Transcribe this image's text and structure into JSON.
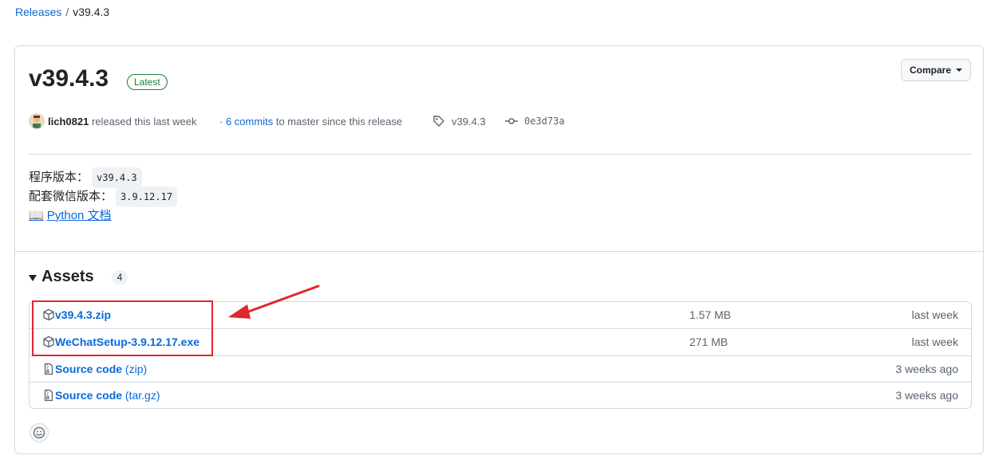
{
  "breadcrumb": {
    "releases": "Releases",
    "separator": "/",
    "current": "v39.4.3"
  },
  "release": {
    "title": "v39.4.3",
    "badge": "Latest",
    "compare_label": "Compare",
    "author": "lich0821",
    "released_text": "released this last week",
    "commits_prefix": "·",
    "commits_link": "6 commits",
    "commits_suffix": "to master since this release",
    "tag": "v39.4.3",
    "commit_sha": "0e3d73a"
  },
  "body": {
    "program_version_label": "程序版本：",
    "program_version": "v39.4.3",
    "wechat_version_label": "配套微信版本：",
    "wechat_version": "3.9.12.17",
    "doc_emoji": "📖",
    "doc_link": "Python 文档"
  },
  "assets": {
    "label": "Assets",
    "count": "4",
    "items": [
      {
        "name": "v39.4.3.zip",
        "sub": "",
        "size": "1.57 MB",
        "date": "last week",
        "icon": "package-icon"
      },
      {
        "name": "WeChatSetup-3.9.12.17.exe",
        "sub": "",
        "size": "271 MB",
        "date": "last week",
        "icon": "package-icon"
      },
      {
        "name": "Source code",
        "sub": "(zip)",
        "size": "",
        "date": "3 weeks ago",
        "icon": "file-zip-icon"
      },
      {
        "name": "Source code",
        "sub": "(tar.gz)",
        "size": "",
        "date": "3 weeks ago",
        "icon": "file-zip-icon"
      }
    ]
  },
  "colors": {
    "link": "#0969da",
    "latest": "#1a7f37",
    "annotation": "#e0262e",
    "border": "#d1d9e0"
  }
}
